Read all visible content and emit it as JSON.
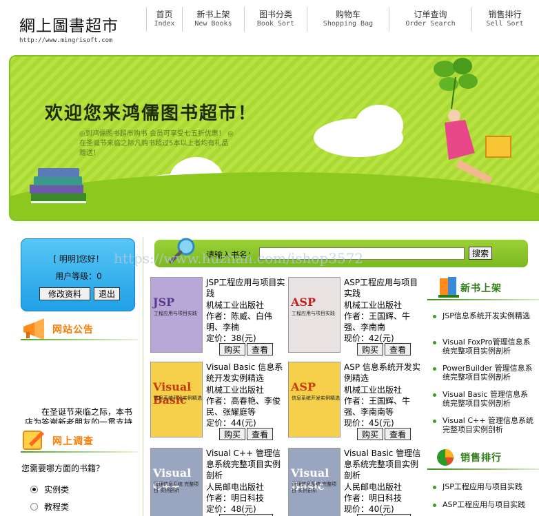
{
  "header": {
    "logo_text": "網上圖書超市",
    "logo_url": "http://www.mingrisoft.com",
    "nav": [
      {
        "cn": "首页",
        "en": "Index"
      },
      {
        "cn": "新书上架",
        "en": "New Books"
      },
      {
        "cn": "图书分类",
        "en": "Book Sort"
      },
      {
        "cn": "购物车",
        "en": "Shopping Bag"
      },
      {
        "cn": "订单查询",
        "en": "Order Search"
      },
      {
        "cn": "销售排行",
        "en": "Sell Sort"
      }
    ]
  },
  "banner": {
    "title": "欢迎您来鸿儒图书超市！",
    "desc": "◎到鸿儒图书超市购书 会员可享受七五折优惠！ ◎在圣诞节来临之际凡购书超过5本以上者均有礼品赠送！"
  },
  "user": {
    "greeting": "[ 明明]您好！",
    "level": "用户等级：0",
    "edit_label": "修改资料",
    "logout_label": "退出"
  },
  "notice": {
    "title": "网站公告",
    "text": "在圣诞节来临之际，本书店为答谢新老朋友的一贯支持"
  },
  "survey": {
    "title": "网上调查",
    "question": "您需要哪方面的书籍？",
    "options": [
      "实例类",
      "教程类"
    ],
    "selected": 0
  },
  "search": {
    "label": "请输入书名：",
    "value": "",
    "button": "搜索"
  },
  "books": [
    {
      "title": "JSP工程应用与项目实践",
      "publisher": "机械工业出版社",
      "author": "作者：陈威、白伟明、李楠",
      "price": "定价：38(元)",
      "cover_tag": "JSP",
      "cover_sub": "工程应用与项目实践",
      "cover_color": "#b8a8d8",
      "tag_color": "#5a3a8a"
    },
    {
      "title": "ASP工程应用与项目实践",
      "publisher": "机械工业出版社",
      "author": "作者：王国辉、牛强、李南南",
      "price": "现价：42(元)",
      "cover_tag": "ASP",
      "cover_sub": "工程应用与项目实践",
      "cover_color": "#e8e2e2",
      "tag_color": "#c81e1e"
    },
    {
      "title": "Visual Basic 信息系统开发实例精选",
      "publisher": "机械工业出版社",
      "author": "作者：高春艳、李俊民、张耀庭等",
      "price": "定价：44(元)",
      "cover_tag": "Visual Basic",
      "cover_sub": "信息系统开发实例精选",
      "cover_color": "#f6d04a",
      "tag_color": "#c83a0c"
    },
    {
      "title": "ASP 信息系统开发实例精选",
      "publisher": "机械工业出版社",
      "author": "作者：王国辉、牛强、李南南等",
      "price": "现价：45(元)",
      "cover_tag": "ASP",
      "cover_sub": "信息系统开发实例精选",
      "cover_color": "#f6d04a",
      "tag_color": "#c83a0c"
    },
    {
      "title": "Visual C++ 管理信息系统完整项目实例剖析",
      "publisher": "人民邮电出版社",
      "author": "作者：明日科技",
      "price": "定价：48(元)",
      "cover_tag": "Visual C++",
      "cover_sub": "管理信息系统 完整项目 实例剖析",
      "cover_color": "#9aa6c0",
      "tag_color": "#ffffff"
    },
    {
      "title": "Visual Basic 管理信息系统完整项目实例剖析",
      "publisher": "人民邮电出版社",
      "author": "作者：明日科技",
      "price": "现价：40(元)",
      "cover_tag": "Visual Basic",
      "cover_sub": "管理信息系统 完整项目 实例剖析",
      "cover_color": "#9aa6c0",
      "tag_color": "#ffffff"
    }
  ],
  "book_buttons": {
    "buy": "购买",
    "view": "查看"
  },
  "new_books": {
    "title": "新书上架",
    "items": [
      "JSP信息系统开发实例精选",
      "Visual FoxPro管理信息系统完整项目实例剖析",
      "PowerBuilder 管理信息系统完整项目实例剖析",
      "Visual Basic 管理信息系统完整项目实例剖析",
      "Visual C++ 管理信息系统完整项目实例剖析"
    ]
  },
  "sales_rank": {
    "title": "销售排行",
    "items": [
      "JSP工程应用与项目实践",
      "ASP工程应用与项目实践"
    ]
  },
  "watermark": "https://www.huzhan.com/ishop3572",
  "colors": {
    "accent_green": "#7cc51a",
    "user_box_blue": "#2aa8ea",
    "notice_orange": "#ff7a00",
    "list_green": "#2b7a14"
  }
}
